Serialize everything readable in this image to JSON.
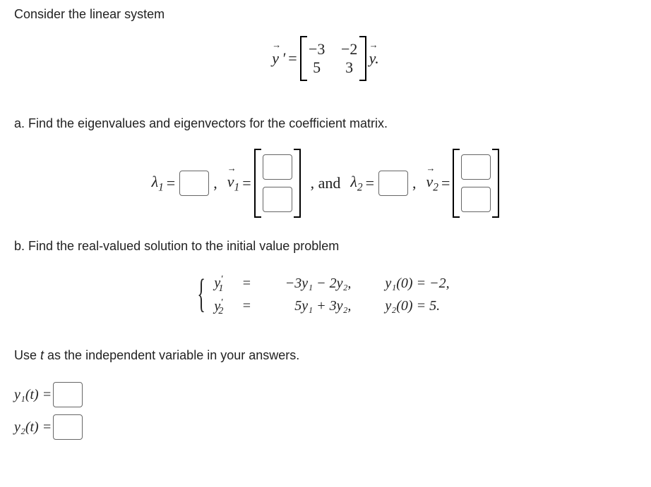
{
  "intro": "Consider the linear system",
  "main_eq": {
    "lhs": "y⃗ ′ =",
    "matrix": [
      [
        "−3",
        "−2"
      ],
      [
        "5",
        "3"
      ]
    ],
    "rhs": "y⃗."
  },
  "part_a": {
    "label": "a. Find the eigenvalues and eigenvectors for the coefficient matrix.",
    "lambda1_lhs": "λ",
    "lambda1_sub": "1",
    "eq": " = ",
    "v1_lhs": "v⃗",
    "v1_sub": "1",
    "between": " , and ",
    "lambda2_sub": "2",
    "v2_sub": "2"
  },
  "part_b": {
    "label": "b. Find the real-valued solution to the initial value problem",
    "sys": {
      "r1_lhs_y": "y",
      "r1_lhs_sub": "1",
      "r1_lhs_prime": "′",
      "r1_eq": "=",
      "r1_rhs": "−3y₁ − 2y₂,",
      "r1_ic": "y₁(0) = −2,",
      "r2_lhs_y": "y",
      "r2_lhs_sub": "2",
      "r2_lhs_prime": "′",
      "r2_eq": "=",
      "r2_rhs": "5y₁ + 3y₂,",
      "r2_ic": "y₂(0) = 5."
    },
    "note": "Use t as the independent variable in your answers.",
    "sol": {
      "y1_lhs": "y₁(t) = ",
      "y2_lhs": "y₂(t) = "
    }
  }
}
